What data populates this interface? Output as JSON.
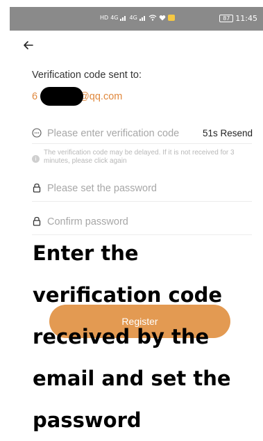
{
  "status_bar": {
    "network_label": "HD",
    "signal_label_1": "4G",
    "signal_label_2": "4G",
    "battery": "87",
    "time": "11:45"
  },
  "back_icon": "arrow-left-icon",
  "verification": {
    "sent_label": "Verification code sent to:",
    "email_prefix": "6",
    "email_suffix": "@qq.com"
  },
  "code_field": {
    "icon": "chat-bubble-icon",
    "placeholder": "Please enter verification code",
    "value": "",
    "resend_label": "51s Resend"
  },
  "delay_note": {
    "icon": "info-icon",
    "text": "The verification code may be delayed. If it is not received for 3 minutes, please click again"
  },
  "password_field": {
    "icon": "lock-icon",
    "placeholder": "Please set the password",
    "value": ""
  },
  "confirm_field": {
    "icon": "lock-icon",
    "placeholder": "Confirm password",
    "value": ""
  },
  "register_button": {
    "label": "Register"
  },
  "overlay_caption": "Enter the verification code received by the email and set the password",
  "colors": {
    "accent": "#e39a52",
    "email_text": "#e0883d",
    "placeholder": "#a7a7a7",
    "status_bar": "#8a8a8a"
  }
}
